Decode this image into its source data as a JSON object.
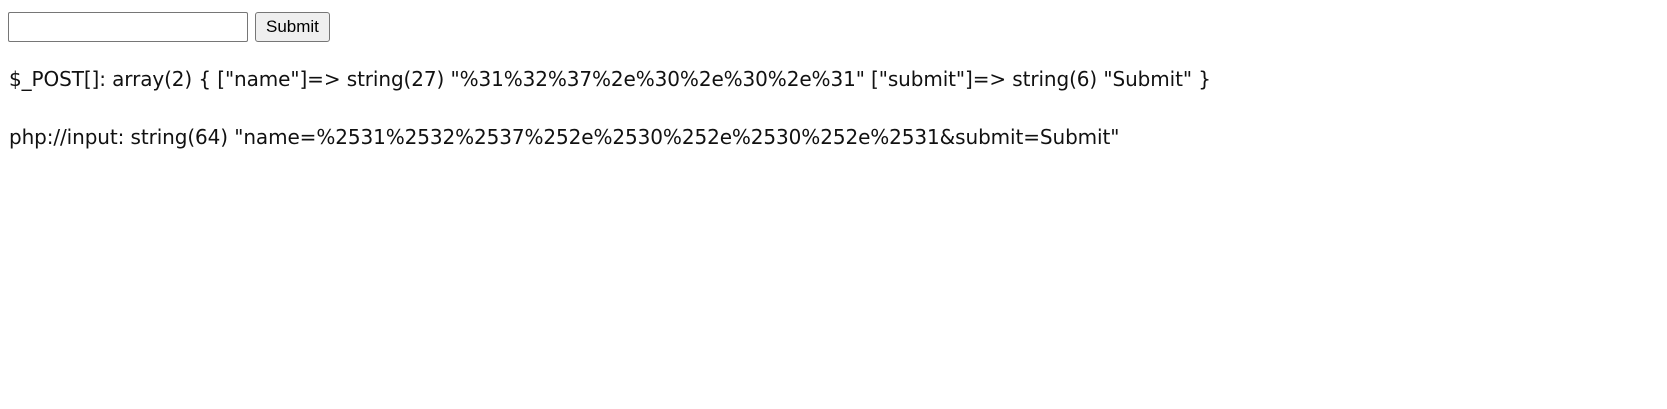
{
  "form": {
    "input_value": "",
    "input_placeholder": "",
    "submit_label": "Submit"
  },
  "output": {
    "post_dump": "$_POST[]: array(2) { [\"name\"]=> string(27) \"%31%32%37%2e%30%2e%30%2e%31\" [\"submit\"]=> string(6) \"Submit\" }",
    "input_dump": "php://input: string(64) \"name=%2531%2532%2537%252e%2530%252e%2530%252e%2531&submit=Submit\""
  }
}
